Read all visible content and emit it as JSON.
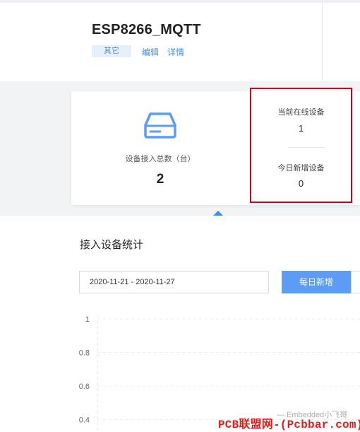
{
  "header": {
    "title": "ESP8266_MQTT",
    "tag": "其它",
    "edit_link": "编辑",
    "detail_link": "详情"
  },
  "stats": {
    "total_label": "设备接入总数（台）",
    "total_value": "2",
    "online_label": "当前在线设备",
    "online_value": "1",
    "new_today_label": "今日新增设备",
    "new_today_value": "0"
  },
  "section": {
    "title": "接入设备统计"
  },
  "filters": {
    "date_range": "2020-11-21 - 2020-11-27",
    "daily_new_button": "每日新增"
  },
  "chart_data": {
    "type": "line",
    "y_ticks": [
      "1",
      "0.8",
      "0.6",
      "0.4"
    ],
    "ylim": [
      0.4,
      1
    ],
    "grid": true
  },
  "watermark": {
    "faint_text": "— Embedded小飞哥",
    "text": "PCB联盟网-(Pcbbar.com)"
  },
  "colors": {
    "accent": "#3d8ef0",
    "button": "#5d9cf5",
    "highlight": "#d0021b",
    "watermark": "#e31a1a"
  },
  "icons": {
    "device": "hard-drive-icon"
  }
}
